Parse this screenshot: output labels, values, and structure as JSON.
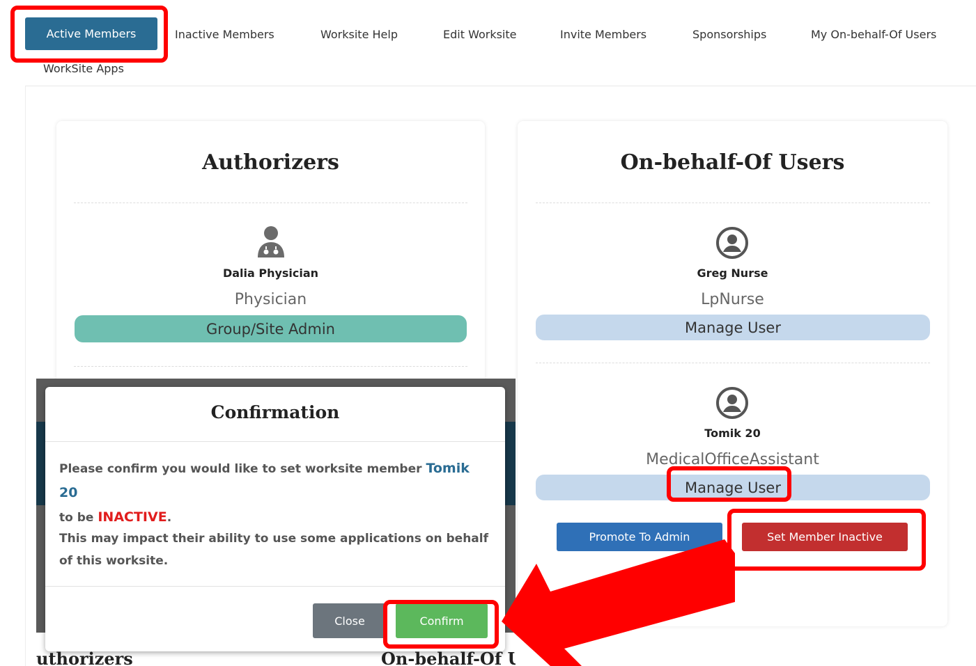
{
  "nav": {
    "tabs": [
      {
        "label": "Active Members",
        "active": true
      },
      {
        "label": "Inactive Members"
      },
      {
        "label": "Worksite Help"
      },
      {
        "label": "Edit Worksite"
      },
      {
        "label": "Invite Members"
      },
      {
        "label": "Sponsorships"
      },
      {
        "label": "My On-behalf-Of Users"
      },
      {
        "label": "WorkSite Apps"
      }
    ]
  },
  "authorizers": {
    "title": "Authorizers",
    "members": [
      {
        "name": "Dalia Physician",
        "role": "Physician",
        "action": "Group/Site Admin",
        "icon": "doctor-icon"
      }
    ]
  },
  "obo": {
    "title": "On-behalf-Of Users",
    "members": [
      {
        "name": "Greg Nurse",
        "role": "LpNurse",
        "action": "Manage User",
        "icon": "user-circle-icon"
      },
      {
        "name": "Tomik 20",
        "role": "MedicalOfficeAssistant",
        "action": "Manage User",
        "icon": "user-circle-icon"
      }
    ],
    "promote_label": "Promote To Admin",
    "inactive_label": "Set Member Inactive"
  },
  "modal": {
    "title": "Confirmation",
    "text_prefix": "Please confirm you would like to set worksite member ",
    "member_name": "Tomik 20",
    "text_mid": "to be ",
    "status_word": "INACTIVE",
    "text_end": ".",
    "impact_text": "This may impact their ability to use some applications on behalf of this worksite.",
    "close_label": "Close",
    "confirm_label": "Confirm"
  },
  "underlay": {
    "left_fragment": "uthorizers",
    "right_fragment": "On-behalf-Of U"
  },
  "colors": {
    "accent": "#2a6c93",
    "admin_pill": "#6fbfb1",
    "manage_pill": "#c5d8ec",
    "promote": "#2f70b7",
    "inactive": "#c22f2f",
    "confirm": "#5cb85c",
    "close": "#6c757d",
    "highlight": "#ff0000"
  }
}
